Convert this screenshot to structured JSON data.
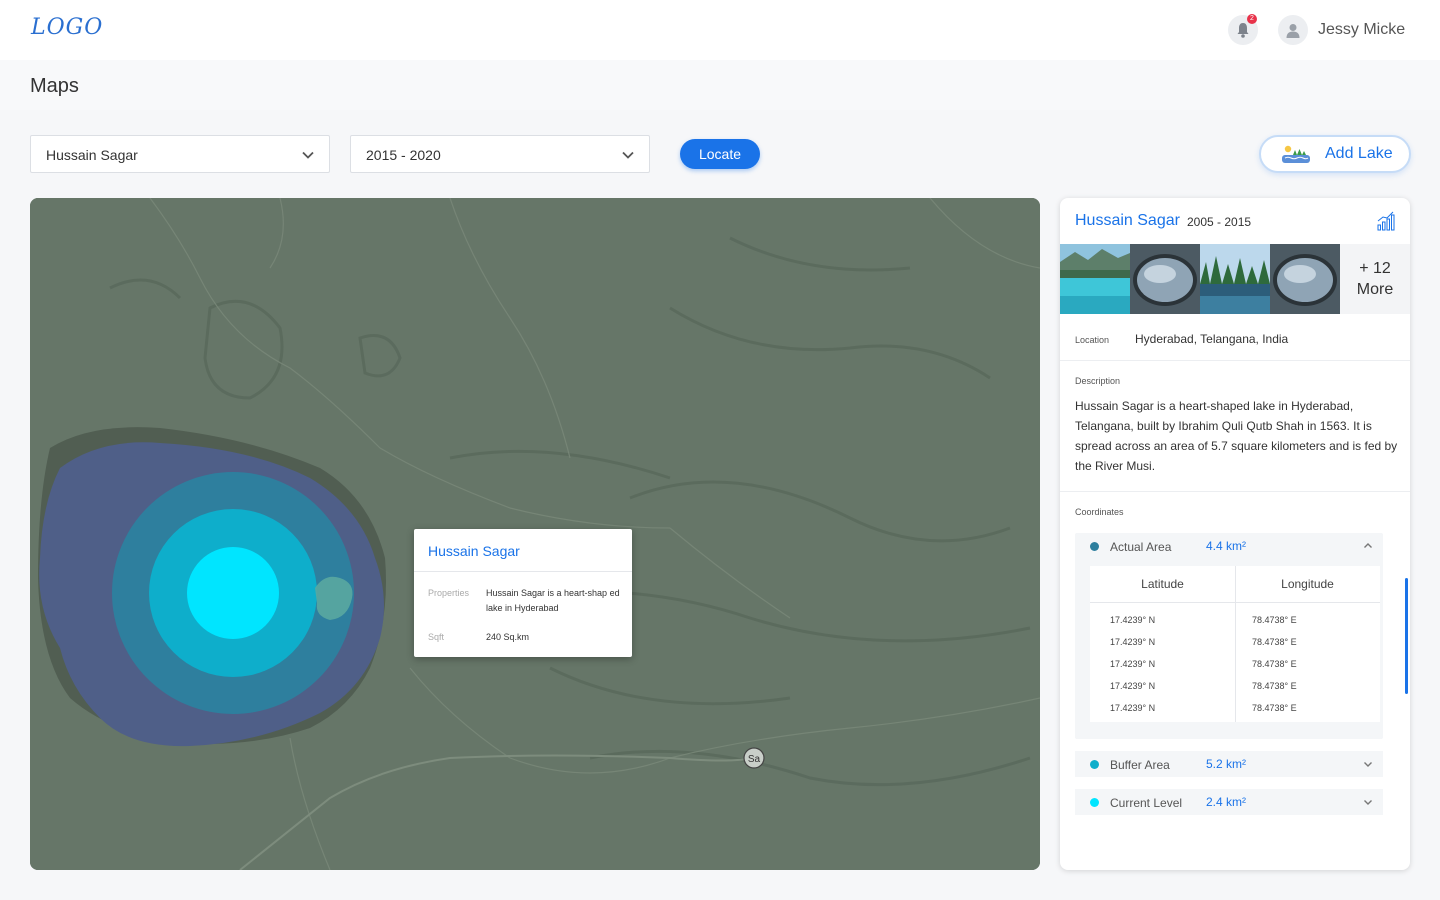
{
  "header": {
    "logo": "LOGO",
    "notification_count": "2",
    "user_name": "Jessy Micke"
  },
  "page": {
    "title": "Maps"
  },
  "filters": {
    "lake_select": "Hussain Sagar",
    "year_select": "2015 - 2020",
    "locate_label": "Locate",
    "add_lake_label": "Add Lake"
  },
  "map": {
    "road_marker": "Sa",
    "popup": {
      "title": "Hussain Sagar",
      "properties_label": "Properties",
      "properties_value": "Hussain Sagar is a heart-shap ed lake in Hyderabad",
      "sqft_label": "Sqft",
      "sqft_value": "240 Sq.km"
    }
  },
  "panel": {
    "title": "Hussain Sagar",
    "years": "2005 - 2015",
    "more_count": "+ 12",
    "more_label": "More",
    "location_label": "Location",
    "location_value": "Hyderabad, Telangana, India",
    "description_label": "Description",
    "description_text": "Hussain Sagar is a heart-shaped lake in Hyderabad, Telangana, built by Ibrahim Quli Qutb Shah in 1563. It is spread across an area of 5.7 square kilometers and is fed by the River Musi.",
    "coordinates_label": "Coordinates",
    "areas": [
      {
        "name": "Actual Area",
        "value": "4.4 km²",
        "color": "#2e7f9e",
        "expanded": true
      },
      {
        "name": "Buffer Area",
        "value": "5.2 km²",
        "color": "#0eaecb",
        "expanded": false
      },
      {
        "name": "Current Level",
        "value": "2.4 km²",
        "color": "#00e5ff",
        "expanded": false
      }
    ],
    "table": {
      "col_latitude": "Latitude",
      "col_longitude": "Longitude",
      "rows": [
        {
          "lat": "17.4239° N",
          "lon": "78.4738° E"
        },
        {
          "lat": "17.4239° N",
          "lon": "78.4738° E"
        },
        {
          "lat": "17.4239° N",
          "lon": "78.4738° E"
        },
        {
          "lat": "17.4239° N",
          "lon": "78.4738° E"
        },
        {
          "lat": "17.4239° N",
          "lon": "78.4738° E"
        }
      ]
    }
  },
  "colors": {
    "accent": "#1a73e8",
    "map_terrain": "#667668",
    "lake_fill": "#4f5f88"
  }
}
